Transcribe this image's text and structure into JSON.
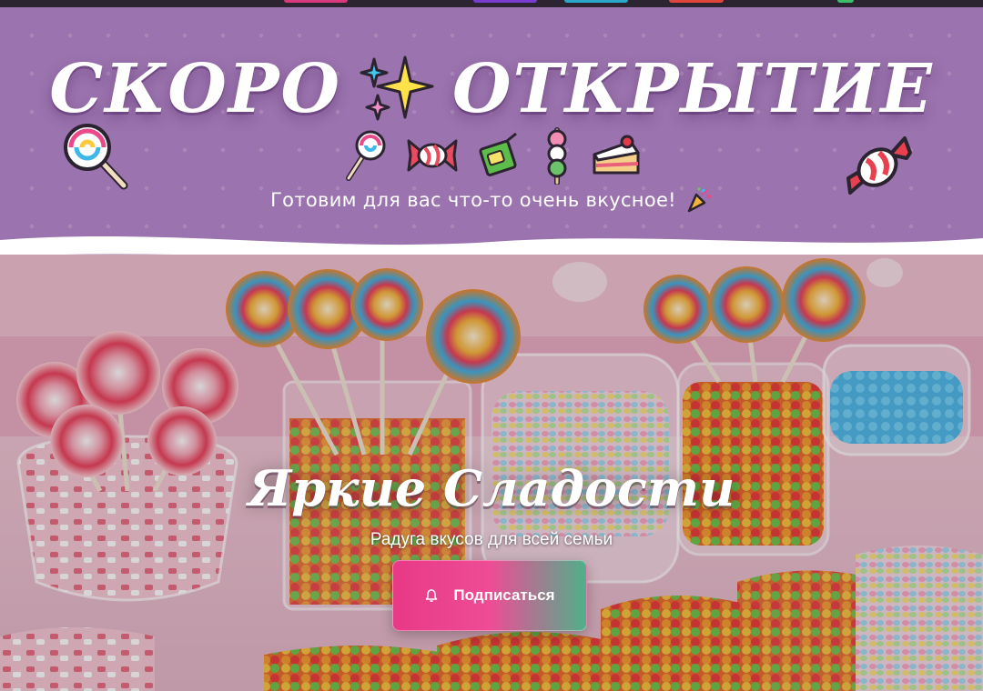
{
  "header": {
    "title_word_1": "СКОРО",
    "title_word_2": "ОТКРЫТИЕ",
    "tagline": "Готовим для вас что-то очень вкусное!",
    "decor_icons": [
      "lollipop-icon",
      "candy-icon",
      "juice-box-icon",
      "dango-icon",
      "cake-slice-icon",
      "sparkles-icon",
      "party-popper-icon"
    ]
  },
  "hero": {
    "title": "Яркие Сладости",
    "subtitle": "Радуга вкусов для всей семьи",
    "button_label": "Подписаться",
    "button_icon": "bell-icon"
  },
  "colors": {
    "header_bg": "#9b73ae",
    "button_pink": "#e83a86",
    "button_green": "#4fb08a"
  }
}
